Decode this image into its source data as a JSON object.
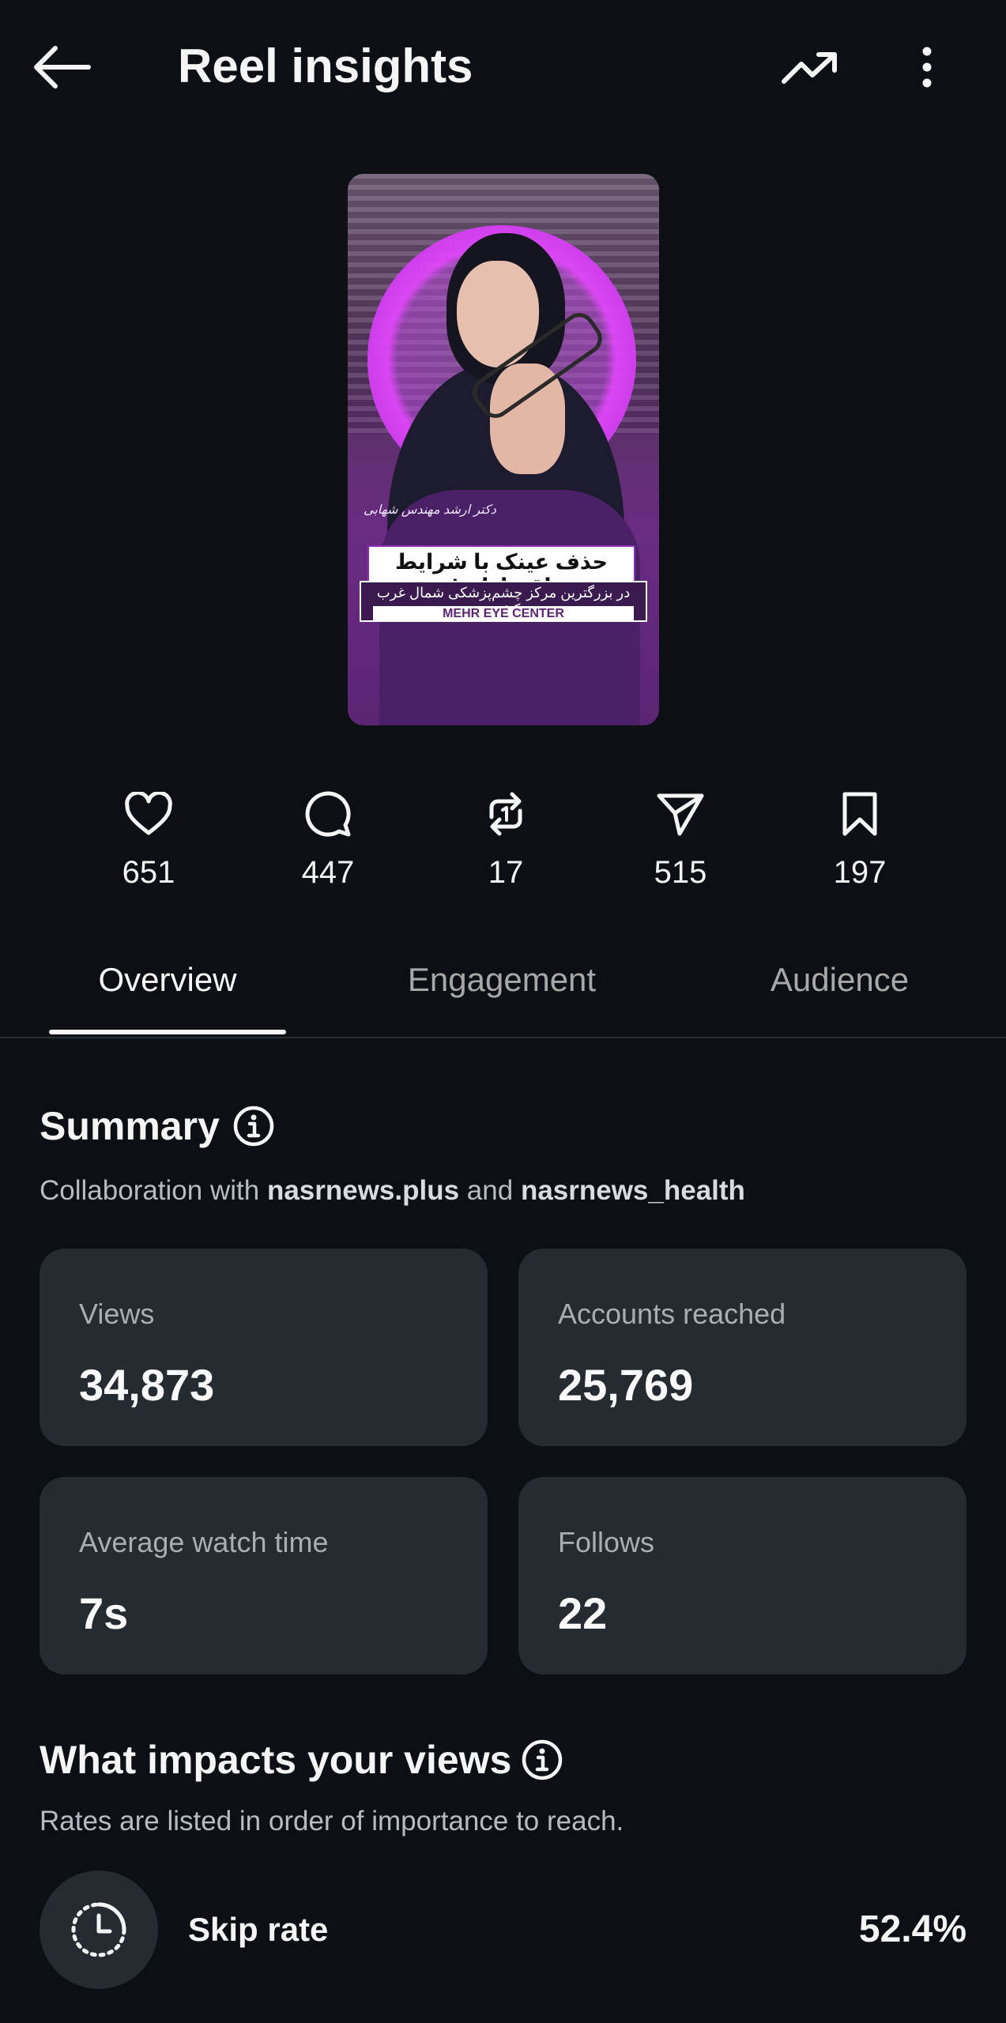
{
  "header": {
    "title": "Reel insights"
  },
  "thumbnail": {
    "handwriting": "دکتر ارشد مهندس شهابی",
    "headline": "حذف عینک با شرایط اقساطی!",
    "subheadline": "در بزرگترین مرکز چشم‌پزشکی شمال غرب کشور",
    "brand": "MEHR EYE CENTER"
  },
  "stats": [
    {
      "icon": "heart-icon",
      "value": "651"
    },
    {
      "icon": "comment-icon",
      "value": "447"
    },
    {
      "icon": "repost-icon",
      "value": "17"
    },
    {
      "icon": "share-icon",
      "value": "515"
    },
    {
      "icon": "bookmark-icon",
      "value": "197"
    }
  ],
  "tabs": [
    {
      "label": "Overview",
      "active": true
    },
    {
      "label": "Engagement",
      "active": false
    },
    {
      "label": "Audience",
      "active": false
    }
  ],
  "summary": {
    "title": "Summary",
    "collab_prefix": "Collaboration with ",
    "collab_account1": "nasrnews.plus",
    "collab_and": " and ",
    "collab_account2": "nasrnews_health",
    "cards": [
      {
        "label": "Views",
        "value": "34,873"
      },
      {
        "label": "Accounts reached",
        "value": "25,769"
      },
      {
        "label": "Average watch time",
        "value": "7s"
      },
      {
        "label": "Follows",
        "value": "22"
      }
    ]
  },
  "impact": {
    "title": "What impacts your views",
    "subtitle": "Rates are listed in order of importance to reach.",
    "rows": [
      {
        "label": "Skip rate",
        "value": "52.4%",
        "icon": "timer-icon"
      }
    ]
  },
  "colors": {
    "background": "#0c1014",
    "card": "#262a31",
    "text": "#f5f5f5",
    "muted": "#a8a8a8"
  }
}
